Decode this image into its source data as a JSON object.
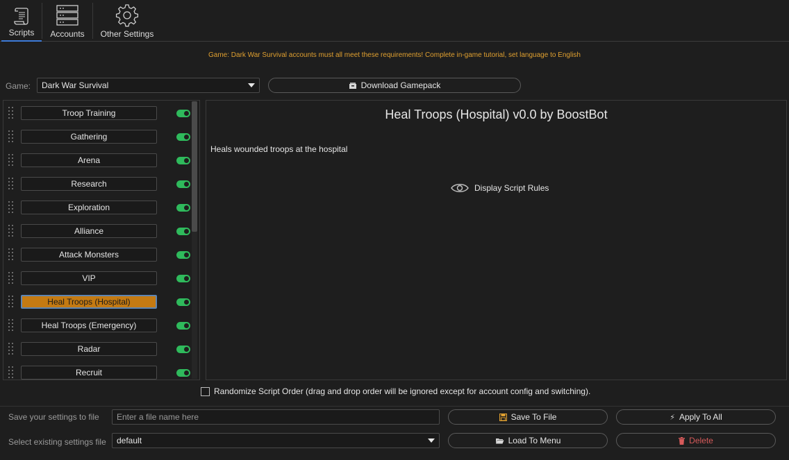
{
  "tabs": [
    {
      "label": "Scripts",
      "icon": "scroll-icon",
      "active": true
    },
    {
      "label": "Accounts",
      "icon": "server-icon",
      "active": false
    },
    {
      "label": "Other Settings",
      "icon": "gear-icon",
      "active": false
    }
  ],
  "notice": "Game: Dark War Survival accounts must all meet these requirements! Complete in-game tutorial, set language to English",
  "game": {
    "label": "Game:",
    "selected": "Dark War Survival",
    "download_label": "Download Gamepack"
  },
  "scripts": [
    {
      "label": "Troop Training",
      "enabled": true
    },
    {
      "label": "Gathering",
      "enabled": true
    },
    {
      "label": "Arena",
      "enabled": true
    },
    {
      "label": "Research",
      "enabled": true
    },
    {
      "label": "Exploration",
      "enabled": true
    },
    {
      "label": "Alliance",
      "enabled": true
    },
    {
      "label": "Attack Monsters",
      "enabled": true
    },
    {
      "label": "VIP",
      "enabled": true
    },
    {
      "label": "Heal Troops (Hospital)",
      "enabled": true,
      "selected": true
    },
    {
      "label": "Heal Troops (Emergency)",
      "enabled": true
    },
    {
      "label": "Radar",
      "enabled": true
    },
    {
      "label": "Recruit",
      "enabled": true
    }
  ],
  "details": {
    "title": "Heal Troops (Hospital) v0.0 by BoostBot",
    "description": "Heals wounded troops at the hospital",
    "rules_label": "Display Script Rules"
  },
  "randomize_label": "Randomize Script Order (drag and drop order will be ignored except for account config and switching).",
  "settings": {
    "save_label": "Save your settings to file",
    "filename_placeholder": "Enter a file name here",
    "save_button": "Save To File",
    "apply_button": "Apply To All",
    "select_label": "Select existing settings file",
    "selected_file": "default",
    "load_button": "Load To Menu",
    "delete_button": "Delete"
  },
  "colors": {
    "accent_tab": "#3d7bd9",
    "notice": "#e0a030",
    "toggle_on": "#2fba5c",
    "selected_script": "#c47a12",
    "delete": "#d65a5a"
  }
}
